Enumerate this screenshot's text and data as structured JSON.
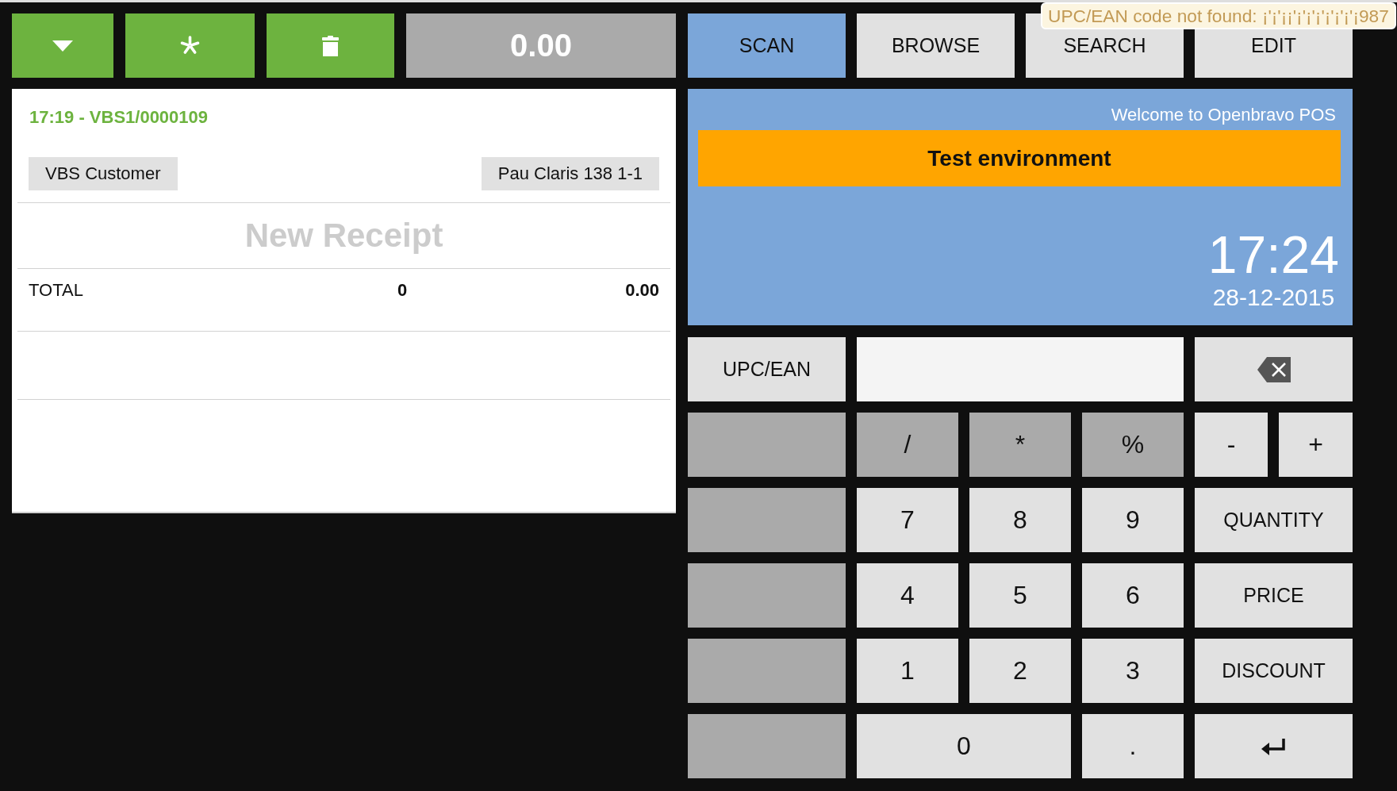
{
  "toolbar": {
    "buttons": [
      {
        "kind": "menu"
      },
      {
        "kind": "new"
      },
      {
        "kind": "delete"
      }
    ],
    "total": "0.00"
  },
  "tabs": [
    {
      "label": "SCAN",
      "selected": true
    },
    {
      "label": "BROWSE",
      "selected": false
    },
    {
      "label": "SEARCH",
      "selected": false
    },
    {
      "label": "EDIT",
      "selected": false
    }
  ],
  "tooltip": {
    "text": "UPC/EAN code not found: ¡'¡'¡¡'¡'¡'¡'¡'¡'¡'¡987"
  },
  "receipt": {
    "header": "17:19 - VBS1/0000109",
    "customer": "VBS Customer",
    "address": "Pau Claris 138 1-1",
    "title": "New Receipt",
    "total": {
      "label": "TOTAL",
      "quantity": "0",
      "amount": "0.00"
    }
  },
  "welcome": {
    "message": "Welcome to Openbravo POS",
    "environment": "Test environment",
    "time": "17:24",
    "date": "28-12-2015"
  },
  "entry": {
    "label": "UPC/EAN"
  },
  "keypad": {
    "keys": [
      {
        "kind": "blank"
      },
      {
        "kind": "operator",
        "label": "/"
      },
      {
        "kind": "operator",
        "label": "*"
      },
      {
        "kind": "operator",
        "label": "%"
      },
      {
        "kind": "sign",
        "label": "-"
      },
      {
        "kind": "sign",
        "label": "+"
      },
      {
        "kind": "blank"
      },
      {
        "kind": "digit",
        "label": "7"
      },
      {
        "kind": "digit",
        "label": "8"
      },
      {
        "kind": "digit",
        "label": "9"
      },
      {
        "kind": "action",
        "label": "QUANTITY"
      },
      {
        "kind": "blank"
      },
      {
        "kind": "digit",
        "label": "4"
      },
      {
        "kind": "digit",
        "label": "5"
      },
      {
        "kind": "digit",
        "label": "6"
      },
      {
        "kind": "action",
        "label": "PRICE"
      },
      {
        "kind": "blank"
      },
      {
        "kind": "digit",
        "label": "1"
      },
      {
        "kind": "digit",
        "label": "2"
      },
      {
        "kind": "digit",
        "label": "3"
      },
      {
        "kind": "action",
        "label": "DISCOUNT"
      },
      {
        "kind": "blank"
      },
      {
        "kind": "wide-digit",
        "label": "0"
      },
      {
        "kind": "digit",
        "label": "."
      },
      {
        "kind": "enter"
      }
    ]
  }
}
